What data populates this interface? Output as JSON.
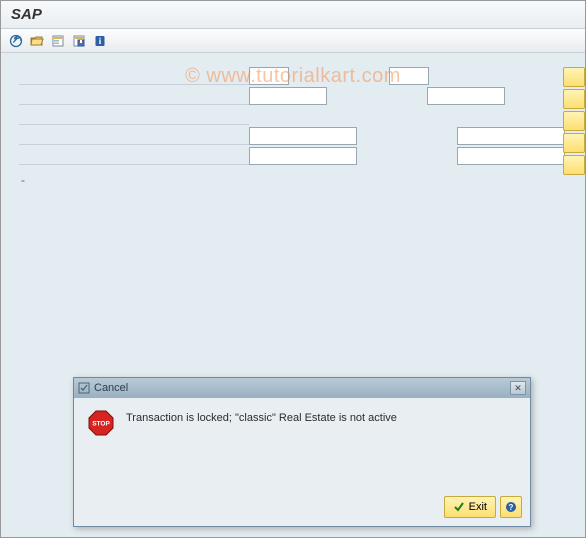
{
  "titlebar": {
    "title": "SAP"
  },
  "watermark": "© www.tutorialkart.com",
  "toolbar": {
    "icons": [
      "execute-icon",
      "folder-open-icon",
      "variant-icon",
      "save-variant-icon",
      "info-icon"
    ]
  },
  "form": {
    "rows": [
      {
        "inputs": [
          {
            "size": "small"
          },
          {
            "size": "small"
          }
        ]
      },
      {
        "inputs": [
          {
            "size": "med"
          },
          {
            "size": "med"
          }
        ]
      },
      {
        "inputs": []
      },
      {
        "inputs": [
          {
            "size": "long"
          },
          {
            "size": "long"
          }
        ]
      },
      {
        "inputs": [
          {
            "size": "long"
          },
          {
            "size": "long"
          }
        ]
      }
    ],
    "right_button_count": 5,
    "dash": "-"
  },
  "dialog": {
    "title": "Cancel",
    "message": "Transaction is locked; \"classic\" Real Estate is not active",
    "exit_label": "Exit"
  }
}
